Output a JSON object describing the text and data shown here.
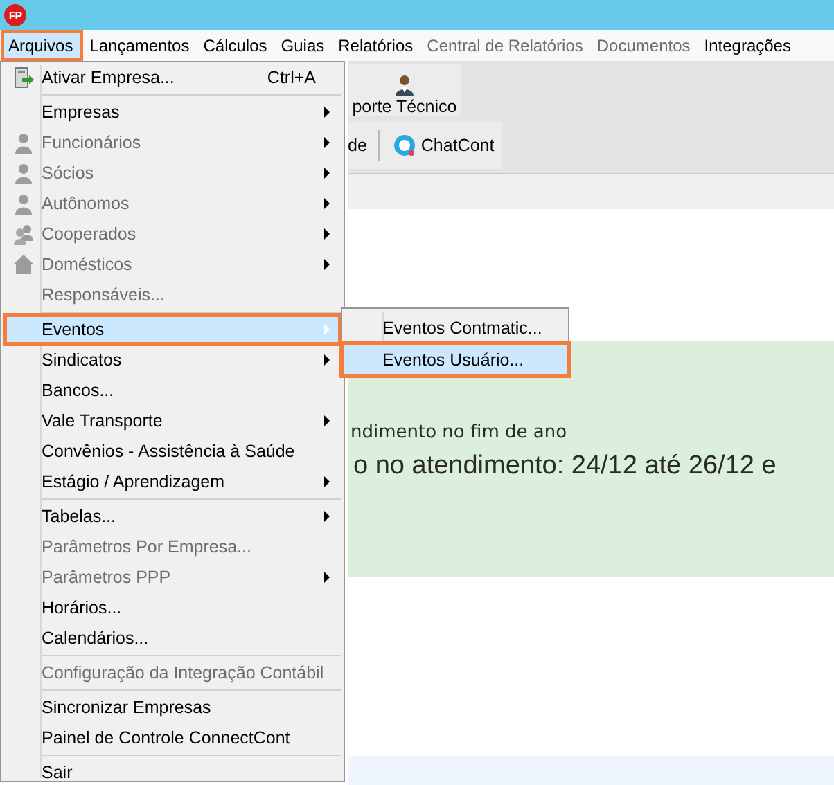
{
  "app_icon": {
    "text": "FP"
  },
  "menubar": [
    {
      "label": "Arquivos",
      "selected": true,
      "disabled": false
    },
    {
      "label": "Lançamentos",
      "selected": false,
      "disabled": false
    },
    {
      "label": "Cálculos",
      "selected": false,
      "disabled": false
    },
    {
      "label": "Guias",
      "selected": false,
      "disabled": false
    },
    {
      "label": "Relatórios",
      "selected": false,
      "disabled": false
    },
    {
      "label": "Central de Relatórios",
      "selected": false,
      "disabled": true
    },
    {
      "label": "Documentos",
      "selected": false,
      "disabled": true
    },
    {
      "label": "Integrações",
      "selected": false,
      "disabled": false
    }
  ],
  "toolbar": {
    "support_button": "porte Técnico",
    "row2_label": "de",
    "chat_button": "ChatCont"
  },
  "notice": {
    "subtitle": "ndimento no fim de ano",
    "headline": "o no atendimento: 24/12 até 26/12 e"
  },
  "menu": [
    {
      "kind": "activate",
      "label": "Ativar Empresa...",
      "shortcut": "Ctrl+A",
      "disabled": false,
      "submenu": false,
      "selected": false
    },
    {
      "kind": "separator"
    },
    {
      "kind": "item",
      "label": "Empresas",
      "disabled": false,
      "submenu": true,
      "selected": false
    },
    {
      "kind": "person",
      "label": "Funcionários",
      "disabled": true,
      "submenu": true,
      "selected": false
    },
    {
      "kind": "person",
      "label": "Sócios",
      "disabled": true,
      "submenu": true,
      "selected": false
    },
    {
      "kind": "person",
      "label": "Autônomos",
      "disabled": true,
      "submenu": true,
      "selected": false
    },
    {
      "kind": "group",
      "label": "Cooperados",
      "disabled": true,
      "submenu": true,
      "selected": false
    },
    {
      "kind": "home",
      "label": "Domésticos",
      "disabled": true,
      "submenu": true,
      "selected": false
    },
    {
      "kind": "item",
      "label": "Responsáveis...",
      "disabled": true,
      "submenu": false,
      "selected": false
    },
    {
      "kind": "separator"
    },
    {
      "kind": "item",
      "label": "Eventos",
      "disabled": false,
      "submenu": true,
      "selected": true
    },
    {
      "kind": "item",
      "label": "Sindicatos",
      "disabled": false,
      "submenu": true,
      "selected": false
    },
    {
      "kind": "item",
      "label": "Bancos...",
      "disabled": false,
      "submenu": false,
      "selected": false
    },
    {
      "kind": "item",
      "label": "Vale Transporte",
      "disabled": false,
      "submenu": true,
      "selected": false
    },
    {
      "kind": "item",
      "label": "Convênios - Assistência à Saúde",
      "disabled": false,
      "submenu": false,
      "selected": false
    },
    {
      "kind": "item",
      "label": "Estágio / Aprendizagem",
      "disabled": false,
      "submenu": true,
      "selected": false
    },
    {
      "kind": "separator"
    },
    {
      "kind": "item",
      "label": "Tabelas...",
      "disabled": false,
      "submenu": true,
      "selected": false
    },
    {
      "kind": "item",
      "label": "Parâmetros Por Empresa...",
      "disabled": true,
      "submenu": false,
      "selected": false
    },
    {
      "kind": "item",
      "label": "Parâmetros PPP",
      "disabled": true,
      "submenu": true,
      "selected": false
    },
    {
      "kind": "item",
      "label": "Horários...",
      "disabled": false,
      "submenu": false,
      "selected": false
    },
    {
      "kind": "item",
      "label": "Calendários...",
      "disabled": false,
      "submenu": false,
      "selected": false
    },
    {
      "kind": "separator"
    },
    {
      "kind": "item",
      "label": "Configuração da Integração Contábil",
      "disabled": true,
      "submenu": false,
      "selected": false
    },
    {
      "kind": "separator"
    },
    {
      "kind": "item",
      "label": "Sincronizar Empresas",
      "disabled": false,
      "submenu": false,
      "selected": false
    },
    {
      "kind": "item",
      "label": "Painel de Controle ConnectCont",
      "disabled": false,
      "submenu": false,
      "selected": false
    },
    {
      "kind": "separator"
    },
    {
      "kind": "item",
      "label": "Sair",
      "disabled": false,
      "submenu": false,
      "selected": false
    }
  ],
  "submenu": [
    {
      "label": "Eventos Contmatic...",
      "selected": false
    },
    {
      "label": "Eventos Usuário...",
      "selected": true
    }
  ]
}
